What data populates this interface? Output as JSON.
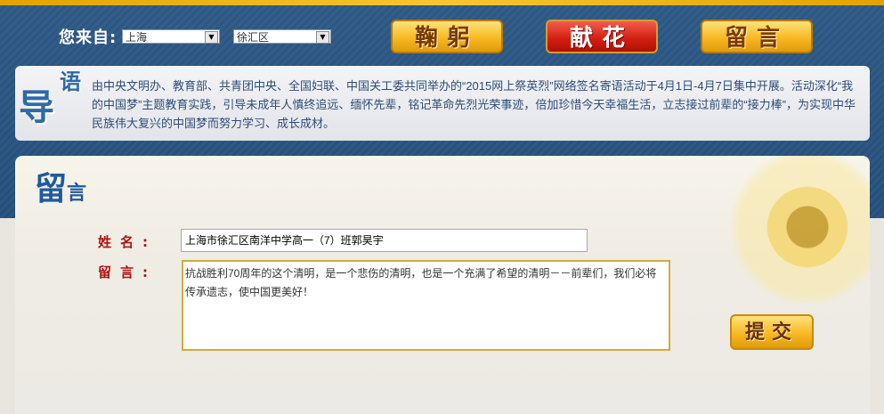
{
  "header": {
    "from_label": "您来自:",
    "province": "上海",
    "district": "徐汇区",
    "bow_label": "鞠躬",
    "flower_label": "献花",
    "message_label": "留言"
  },
  "intro": {
    "title_big": "导",
    "title_small": "语",
    "text": "由中央文明办、教育部、共青团中央、全国妇联、中国关工委共同举办的“2015网上祭英烈”网络签名寄语活动于4月1日-4月7日集中开展。活动深化“我的中国梦”主题教育实践，引导未成年人慎终追远、缅怀先辈，铭记革命先烈光荣事迹，倍加珍惜今天幸福生活，立志接过前辈的“接力棒”，为实现中华民族伟大复兴的中国梦而努力学习、成长成材。"
  },
  "form": {
    "section_title_big": "留",
    "section_title_small": "言",
    "name_label": "姓名:",
    "name_value": "上海市徐汇区南洋中学高一（7）班郭昊宇",
    "message_label": "留言:",
    "message_value": "抗战胜利70周年的这个清明，是一个悲伤的清明，也是一个充满了希望的清明－－前辈们，我们必将传承遗志，使中国更美好！",
    "submit_label": "提交"
  }
}
